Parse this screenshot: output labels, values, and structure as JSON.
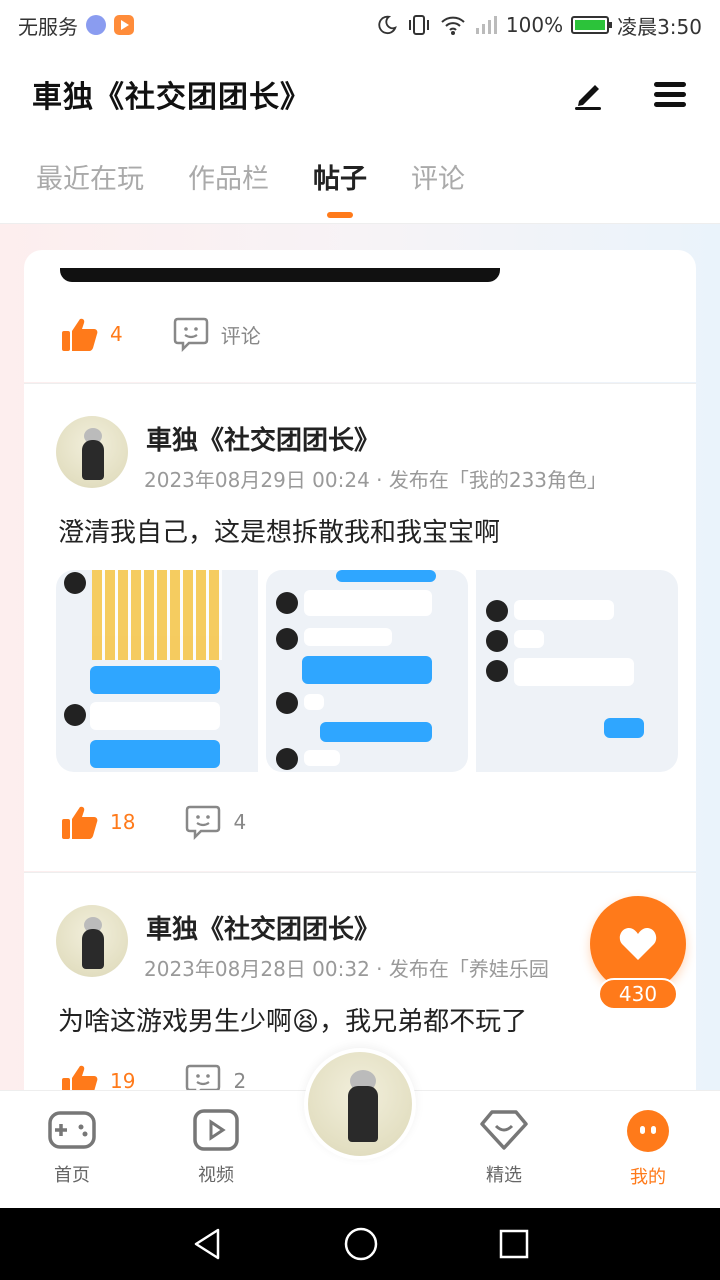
{
  "status_bar": {
    "carrier": "无服务",
    "battery": "100%",
    "time": "凌晨3:50"
  },
  "header": {
    "title": "車独《社交团团长》"
  },
  "tabs": [
    {
      "label": "最近在玩"
    },
    {
      "label": "作品栏"
    },
    {
      "label": "帖子"
    },
    {
      "label": "评论"
    }
  ],
  "top_card": {
    "likes": "4",
    "comment_label": "评论"
  },
  "posts": [
    {
      "author": "車独《社交团团长》",
      "meta": "2023年08月29日 00:24 · 发布在「我的233角色」",
      "text": "澄清我自己，这是想拆散我和我宝宝啊",
      "likes": "18",
      "comments": "4"
    },
    {
      "author": "車独《社交团团长》",
      "meta": "2023年08月28日 00:32 · 发布在「养娃乐园",
      "text": "为啥这游戏男生少啊😫，我兄弟都不玩了",
      "likes": "19",
      "comments": "2"
    }
  ],
  "float_like": {
    "count": "430"
  },
  "bottom_nav": [
    {
      "label": "首页"
    },
    {
      "label": "视频"
    },
    {
      "label": "精选"
    },
    {
      "label": "我的"
    }
  ],
  "colors": {
    "accent": "#ff7a1a"
  }
}
